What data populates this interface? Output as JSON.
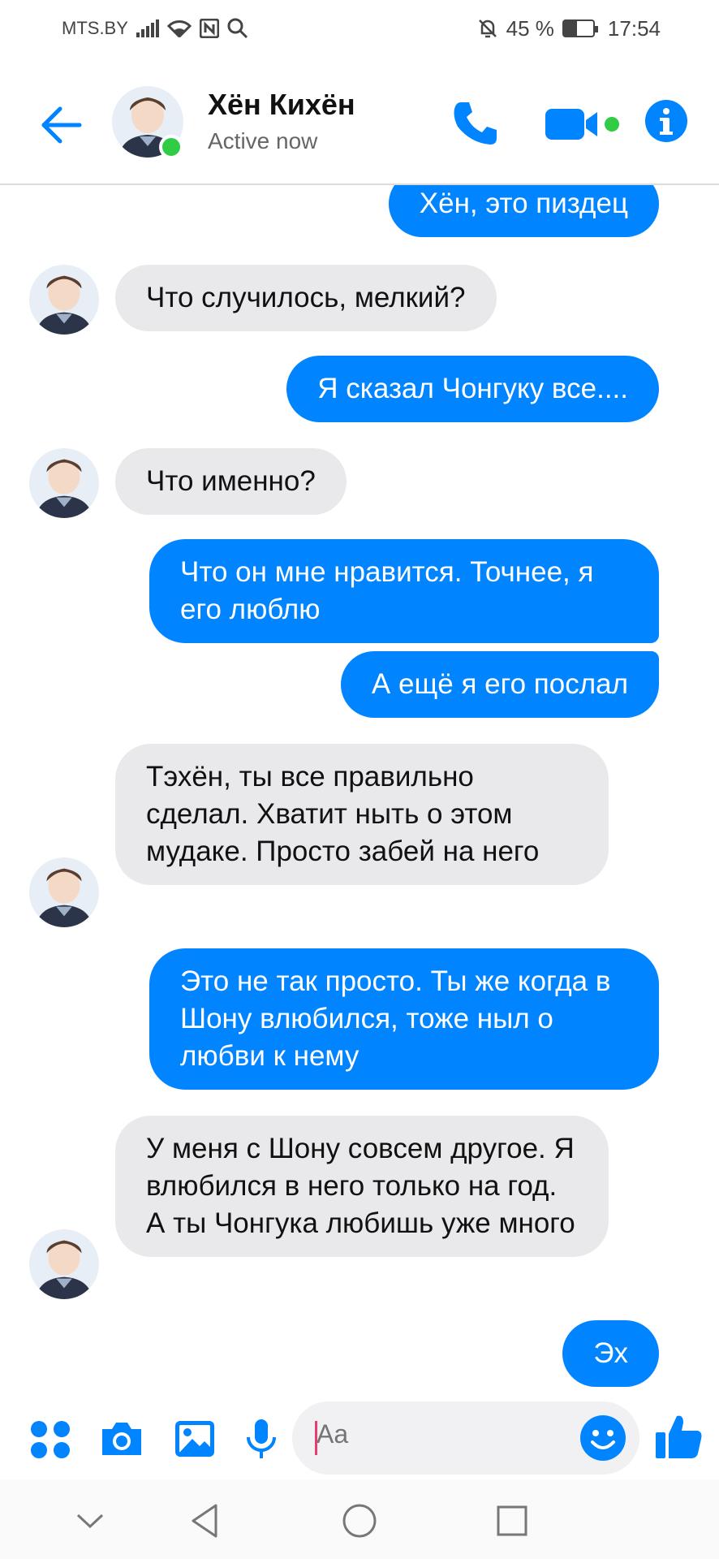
{
  "status_bar": {
    "carrier": "MTS.BY",
    "battery": "45 %",
    "battery_level": 0.45,
    "time": "17:54"
  },
  "header": {
    "contact_name": "Хён Кихён",
    "contact_status": "Active now",
    "accent_color": "#0084ff",
    "online_color": "#31cc46"
  },
  "messages": [
    {
      "side": "out",
      "text": "Хён, это пиздец"
    },
    {
      "side": "in",
      "text": "Что случилось, мелкий?"
    },
    {
      "side": "out",
      "text": "Я сказал Чонгуку все...."
    },
    {
      "side": "in",
      "text": "Что именно?"
    },
    {
      "side": "out",
      "text": "Что он мне нравится. Точнее, я его люблю"
    },
    {
      "side": "out",
      "text": "А ещё я его послал"
    },
    {
      "side": "in",
      "text": "Тэхён, ты все правильно сделал. Хватит ныть о этом мудаке. Просто забей на него"
    },
    {
      "side": "out",
      "text": "Это не так просто. Ты же когда в Шону влюбился, тоже ныл о любви к нему"
    },
    {
      "side": "in",
      "text": "У меня с Шону совсем другое. Я влюбился в него только на год. А ты Чонгука любишь уже много"
    },
    {
      "side": "out",
      "text": "Эх"
    }
  ],
  "composer": {
    "placeholder": "Aa",
    "icons": [
      "apps-icon",
      "camera-icon",
      "gallery-icon",
      "microphone-icon",
      "emoji-icon",
      "thumbs-up-icon"
    ]
  },
  "navbar": {
    "icons": [
      "collapse-icon",
      "back-icon",
      "home-icon",
      "recents-icon"
    ]
  }
}
